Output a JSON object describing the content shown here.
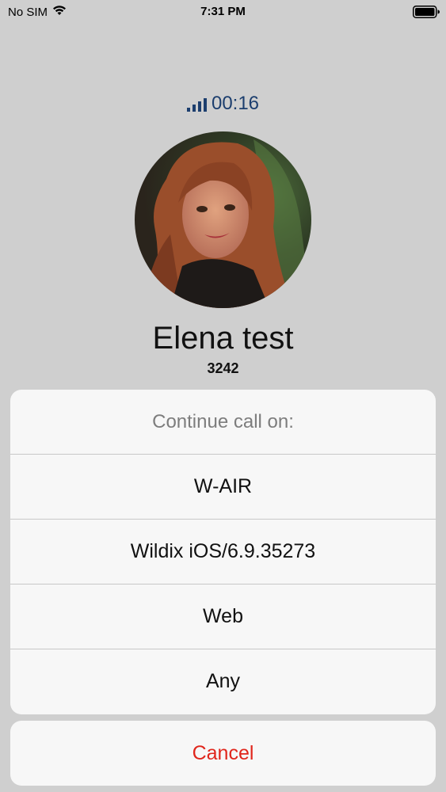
{
  "status_bar": {
    "carrier": "No SIM",
    "time": "7:31 PM"
  },
  "call": {
    "duration": "00:16",
    "contact_name": "Elena test",
    "extension": "3242"
  },
  "action_sheet": {
    "title": "Continue call on:",
    "options": [
      "W-AIR",
      "Wildix iOS/6.9.35273",
      "Web",
      "Any"
    ],
    "cancel_label": "Cancel"
  },
  "colors": {
    "background": "#cfcfcf",
    "sheet": "#f7f7f7",
    "accent_blue": "#1c3e6e",
    "cancel_red": "#e0261c"
  }
}
